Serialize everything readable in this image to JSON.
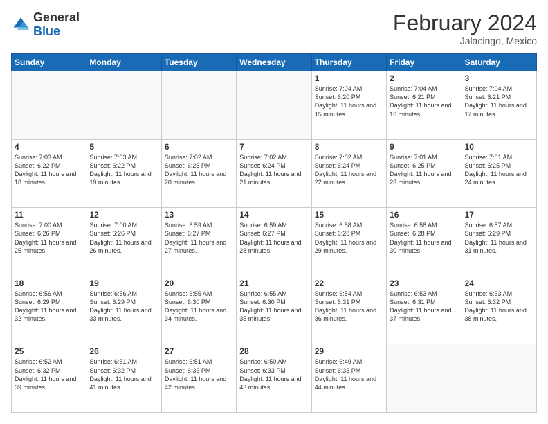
{
  "header": {
    "logo": {
      "general": "General",
      "blue": "Blue"
    },
    "title": "February 2024",
    "location": "Jalacingo, Mexico"
  },
  "calendar": {
    "days_of_week": [
      "Sunday",
      "Monday",
      "Tuesday",
      "Wednesday",
      "Thursday",
      "Friday",
      "Saturday"
    ],
    "weeks": [
      [
        {
          "day": "",
          "info": ""
        },
        {
          "day": "",
          "info": ""
        },
        {
          "day": "",
          "info": ""
        },
        {
          "day": "",
          "info": ""
        },
        {
          "day": "1",
          "info": "Sunrise: 7:04 AM\nSunset: 6:20 PM\nDaylight: 11 hours and 15 minutes."
        },
        {
          "day": "2",
          "info": "Sunrise: 7:04 AM\nSunset: 6:21 PM\nDaylight: 11 hours and 16 minutes."
        },
        {
          "day": "3",
          "info": "Sunrise: 7:04 AM\nSunset: 6:21 PM\nDaylight: 11 hours and 17 minutes."
        }
      ],
      [
        {
          "day": "4",
          "info": "Sunrise: 7:03 AM\nSunset: 6:22 PM\nDaylight: 11 hours and 18 minutes."
        },
        {
          "day": "5",
          "info": "Sunrise: 7:03 AM\nSunset: 6:22 PM\nDaylight: 11 hours and 19 minutes."
        },
        {
          "day": "6",
          "info": "Sunrise: 7:02 AM\nSunset: 6:23 PM\nDaylight: 11 hours and 20 minutes."
        },
        {
          "day": "7",
          "info": "Sunrise: 7:02 AM\nSunset: 6:24 PM\nDaylight: 11 hours and 21 minutes."
        },
        {
          "day": "8",
          "info": "Sunrise: 7:02 AM\nSunset: 6:24 PM\nDaylight: 11 hours and 22 minutes."
        },
        {
          "day": "9",
          "info": "Sunrise: 7:01 AM\nSunset: 6:25 PM\nDaylight: 11 hours and 23 minutes."
        },
        {
          "day": "10",
          "info": "Sunrise: 7:01 AM\nSunset: 6:25 PM\nDaylight: 11 hours and 24 minutes."
        }
      ],
      [
        {
          "day": "11",
          "info": "Sunrise: 7:00 AM\nSunset: 6:26 PM\nDaylight: 11 hours and 25 minutes."
        },
        {
          "day": "12",
          "info": "Sunrise: 7:00 AM\nSunset: 6:26 PM\nDaylight: 11 hours and 26 minutes."
        },
        {
          "day": "13",
          "info": "Sunrise: 6:59 AM\nSunset: 6:27 PM\nDaylight: 11 hours and 27 minutes."
        },
        {
          "day": "14",
          "info": "Sunrise: 6:59 AM\nSunset: 6:27 PM\nDaylight: 11 hours and 28 minutes."
        },
        {
          "day": "15",
          "info": "Sunrise: 6:58 AM\nSunset: 6:28 PM\nDaylight: 11 hours and 29 minutes."
        },
        {
          "day": "16",
          "info": "Sunrise: 6:58 AM\nSunset: 6:28 PM\nDaylight: 11 hours and 30 minutes."
        },
        {
          "day": "17",
          "info": "Sunrise: 6:57 AM\nSunset: 6:29 PM\nDaylight: 11 hours and 31 minutes."
        }
      ],
      [
        {
          "day": "18",
          "info": "Sunrise: 6:56 AM\nSunset: 6:29 PM\nDaylight: 11 hours and 32 minutes."
        },
        {
          "day": "19",
          "info": "Sunrise: 6:56 AM\nSunset: 6:29 PM\nDaylight: 11 hours and 33 minutes."
        },
        {
          "day": "20",
          "info": "Sunrise: 6:55 AM\nSunset: 6:30 PM\nDaylight: 11 hours and 34 minutes."
        },
        {
          "day": "21",
          "info": "Sunrise: 6:55 AM\nSunset: 6:30 PM\nDaylight: 11 hours and 35 minutes."
        },
        {
          "day": "22",
          "info": "Sunrise: 6:54 AM\nSunset: 6:31 PM\nDaylight: 11 hours and 36 minutes."
        },
        {
          "day": "23",
          "info": "Sunrise: 6:53 AM\nSunset: 6:31 PM\nDaylight: 11 hours and 37 minutes."
        },
        {
          "day": "24",
          "info": "Sunrise: 6:53 AM\nSunset: 6:32 PM\nDaylight: 11 hours and 38 minutes."
        }
      ],
      [
        {
          "day": "25",
          "info": "Sunrise: 6:52 AM\nSunset: 6:32 PM\nDaylight: 11 hours and 39 minutes."
        },
        {
          "day": "26",
          "info": "Sunrise: 6:51 AM\nSunset: 6:32 PM\nDaylight: 11 hours and 41 minutes."
        },
        {
          "day": "27",
          "info": "Sunrise: 6:51 AM\nSunset: 6:33 PM\nDaylight: 11 hours and 42 minutes."
        },
        {
          "day": "28",
          "info": "Sunrise: 6:50 AM\nSunset: 6:33 PM\nDaylight: 11 hours and 43 minutes."
        },
        {
          "day": "29",
          "info": "Sunrise: 6:49 AM\nSunset: 6:33 PM\nDaylight: 11 hours and 44 minutes."
        },
        {
          "day": "",
          "info": ""
        },
        {
          "day": "",
          "info": ""
        }
      ]
    ]
  }
}
